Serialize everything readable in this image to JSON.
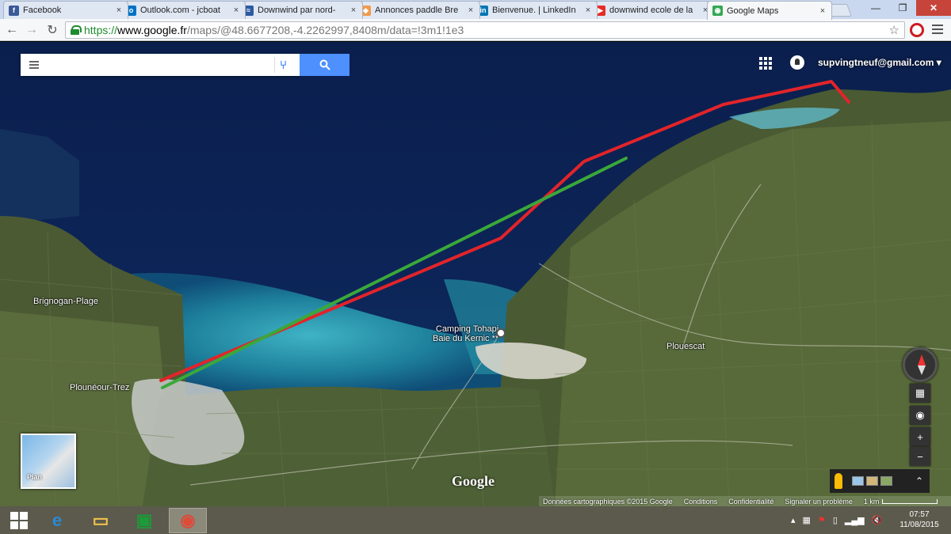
{
  "browser": {
    "tabs": [
      {
        "title": "Facebook",
        "icon": "facebook-icon",
        "color": "#3b5998",
        "glyph": "f",
        "active": false
      },
      {
        "title": "Outlook.com - jcboat",
        "icon": "outlook-icon",
        "color": "#0072c6",
        "glyph": "o",
        "active": false
      },
      {
        "title": "Downwind par nord-",
        "icon": "wave-icon",
        "color": "#2c5aa0",
        "glyph": "≈",
        "active": false
      },
      {
        "title": "Annonces paddle Bre",
        "icon": "annonces-icon",
        "color": "#f2994a",
        "glyph": "◆",
        "active": false
      },
      {
        "title": "Bienvenue. | LinkedIn",
        "icon": "linkedin-icon",
        "color": "#0077b5",
        "glyph": "in",
        "active": false
      },
      {
        "title": "downwind ecole de la",
        "icon": "youtube-icon",
        "color": "#e52d27",
        "glyph": "▶",
        "active": false
      },
      {
        "title": "Google Maps",
        "icon": "google-maps-icon",
        "color": "#34a853",
        "glyph": "◉",
        "active": true
      }
    ],
    "close_glyph": "×",
    "window_controls": {
      "minimize": "—",
      "maximize": "❐",
      "close": "✕"
    },
    "url": {
      "protocol": "https://",
      "host": "www.google.fr",
      "path": "/maps/@48.6677208,-4.2262997,8408m/data=!3m1!1e3"
    },
    "nav": {
      "back": "←",
      "forward": "→",
      "reload": "↻",
      "star": "☆"
    }
  },
  "maps": {
    "search": {
      "placeholder": "",
      "directions_glyph": "⑂",
      "search_glyph": "🔍"
    },
    "account": "supvingtneuf@gmail.com ▾",
    "places": [
      {
        "name": "Brignogan-Plage",
        "label": "Brignogan-Plage"
      },
      {
        "name": "Plouneour-Trez",
        "label": "Plounéour-Trez"
      },
      {
        "name": "Camping Tohapi",
        "label": "Camping Tohapi\nBaie du Kernic **"
      },
      {
        "name": "Plouescat",
        "label": "Plouescat"
      }
    ],
    "controls": {
      "zoom_in": "+",
      "zoom_out": "−",
      "location": "◉",
      "grid": "▦",
      "expand": "⌃"
    },
    "earth_toggle": "Plan",
    "logo": "Google",
    "footer": {
      "copyright": "Données cartographiques ©2015 Google",
      "conditions": "Conditions",
      "privacy": "Confidentialité",
      "report": "Signaler un problème",
      "scale": "1 km"
    },
    "routes": [
      {
        "name": "red-route",
        "color": "#e2242a"
      },
      {
        "name": "green-route",
        "color": "#3aa83a"
      }
    ]
  },
  "taskbar": {
    "apps": [
      {
        "name": "internet-explorer-icon",
        "glyph": "e",
        "color": "#2a8ad4"
      },
      {
        "name": "file-explorer-icon",
        "glyph": "▭",
        "color": "#f3c54d"
      },
      {
        "name": "store-icon",
        "glyph": "▣",
        "color": "#1b9b3a"
      },
      {
        "name": "chrome-icon",
        "glyph": "◉",
        "color": "#dd4b39"
      }
    ],
    "time": "07:57",
    "date": "11/08/2015"
  }
}
